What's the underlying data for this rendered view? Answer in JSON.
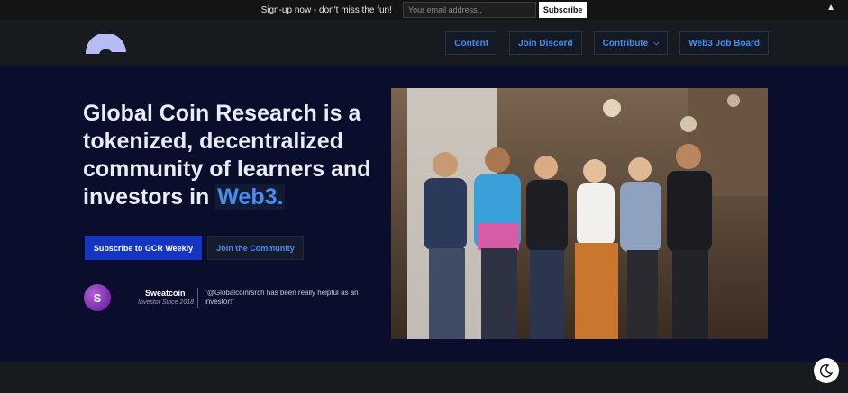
{
  "topbar": {
    "text": "Sign-up now - don't miss the fun!",
    "email_placeholder": "Your email address..",
    "subscribe_label": "Subscribe",
    "collapse_icon": "▲"
  },
  "nav": {
    "logo": "gcr-logo",
    "items": [
      {
        "label": "Content"
      },
      {
        "label": "Join Discord"
      },
      {
        "label": "Contribute",
        "has_dropdown": true
      },
      {
        "label": "Web3 Job Board"
      }
    ]
  },
  "hero": {
    "headline_main": "Global Coin Research is a tokenized, decentralized community of learners and investors in ",
    "headline_accent": "Web3.",
    "cta_primary": "Subscribe to GCR Weekly",
    "cta_secondary": "Join the Community"
  },
  "testimonial": {
    "avatar_letter": "S",
    "name": "Sweatcoin",
    "role": "Investor Since 2018",
    "quote": "\"@Globalcoinrsrch has been really helpful as an investor!\""
  },
  "colors": {
    "accent": "#4a8cf0",
    "primary_button": "#1434c4",
    "hero_bg": "#0a0d2b",
    "nav_bg": "#171a1f"
  },
  "icons": {
    "dropdown": "chevron-down-icon",
    "theme": "moon-icon",
    "collapse": "triangle-up-icon"
  }
}
